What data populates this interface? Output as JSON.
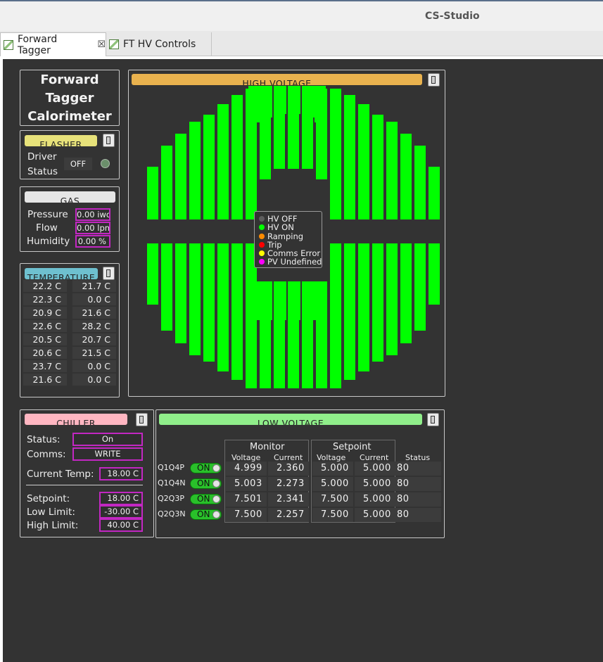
{
  "window": {
    "title": "CS-Studio"
  },
  "tabs": [
    {
      "label": "Forward Tagger",
      "close": "☒"
    },
    {
      "label": "FT HV Controls"
    }
  ],
  "colors": {
    "channel_on": "#00ff00",
    "hv_bar": "#e9b24e",
    "flasher_bar": "#e7e27a",
    "gas_bar": "#e6e6e6",
    "temp_bar": "#6ec0cf",
    "chiller_bar": "#ffb6c1",
    "lv_bar": "#90ee8a",
    "value_border": "#c227c2",
    "background": "#333333"
  },
  "title_box": {
    "lines": [
      "Forward",
      "Tagger",
      "Calorimeter"
    ]
  },
  "flasher": {
    "title": "FLASHER",
    "label_line1": "Driver",
    "label_line2": "Status",
    "state": "OFF"
  },
  "gas": {
    "title": "GAS",
    "rows": [
      {
        "label": "Pressure",
        "value": "0.00 iwc"
      },
      {
        "label": "Flow",
        "value": "0.00 lpm"
      },
      {
        "label": "Humidity",
        "value": "0.00 %"
      }
    ]
  },
  "temperature": {
    "title": "TEMPERATURE",
    "rows": [
      [
        "22.2 C",
        "21.7 C"
      ],
      [
        "22.3 C",
        "0.0 C"
      ],
      [
        "20.9 C",
        "21.6 C"
      ],
      [
        "22.6 C",
        "28.2 C"
      ],
      [
        "20.5 C",
        "20.7 C"
      ],
      [
        "20.6 C",
        "21.5 C"
      ],
      [
        "23.7 C",
        "0.0 C"
      ],
      [
        "21.6 C",
        "0.0 C"
      ]
    ]
  },
  "high_voltage": {
    "title": "HIGH VOLTAGE",
    "legend": [
      {
        "label": "HV OFF",
        "color": "#5d5d5d"
      },
      {
        "label": "HV ON",
        "color": "#00ff00"
      },
      {
        "label": "Ramping",
        "color": "#ff8c00"
      },
      {
        "label": "Trip",
        "color": "#ff0000"
      },
      {
        "label": "Comms Error",
        "color": "#ffff00"
      },
      {
        "label": "PV Undefined",
        "color": "#ff00ff"
      }
    ]
  },
  "chiller": {
    "title": "CHILLER",
    "status_label": "Status:",
    "status_value": "On",
    "comms_label": "Comms:",
    "comms_value": "WRITE",
    "current_temp_label": "Current Temp:",
    "current_temp_value": "18.00 C",
    "setpoint_label": "Setpoint:",
    "setpoint_value": "18.00 C",
    "low_limit_label": "Low Limit:",
    "low_limit_value": "-30.00 C",
    "high_limit_label": "High Limit:",
    "high_limit_value": "40.00 C"
  },
  "low_voltage": {
    "title": "LOW VOLTAGE",
    "monitor_header": "Monitor",
    "setpoint_header": "Setpoint",
    "voltage_header": "Voltage",
    "current_header": "Current",
    "status_header": "Status",
    "rows": [
      {
        "name": "Q1Q4P",
        "toggle": "ON",
        "mon_v": "4.999",
        "mon_i": "2.360",
        "set_v": "5.000",
        "set_i": "5.000",
        "status": "80"
      },
      {
        "name": "Q1Q4N",
        "toggle": "ON",
        "mon_v": "5.003",
        "mon_i": "2.273",
        "set_v": "5.000",
        "set_i": "5.000",
        "status": "80"
      },
      {
        "name": "Q2Q3P",
        "toggle": "ON",
        "mon_v": "7.501",
        "mon_i": "2.341",
        "set_v": "7.500",
        "set_i": "5.000",
        "status": "80"
      },
      {
        "name": "Q2Q3N",
        "toggle": "ON",
        "mon_v": "7.500",
        "mon_i": "2.257",
        "set_v": "7.500",
        "set_i": "5.000",
        "status": "80"
      }
    ]
  }
}
